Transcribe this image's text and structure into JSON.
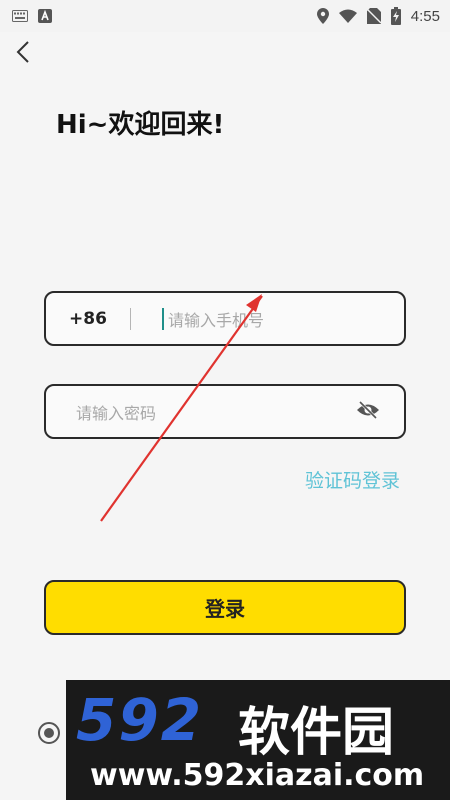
{
  "status_bar": {
    "time": "4:55",
    "icons": [
      "keyboard-icon",
      "a-notification-icon",
      "location-icon",
      "wifi-icon",
      "no-sim-icon",
      "battery-charging-icon"
    ]
  },
  "header": {
    "back_icon": "chevron-left-icon",
    "title": "Hi~欢迎回来!"
  },
  "login_form": {
    "country_code": "+86",
    "phone_placeholder": "请输入手机号",
    "password_placeholder": "请输入密码",
    "password_visibility_icon": "eye-off-icon",
    "code_login_link": "验证码登录",
    "submit_label": "登录"
  },
  "watermark": {
    "logo_number": "592",
    "logo_text": "软件园",
    "url": "www.592xiazai.com"
  },
  "colors": {
    "accent_button": "#ffdd00",
    "link": "#5fc3d6",
    "annotation_arrow": "#e0332f",
    "cursor": "#1f8f8a"
  }
}
